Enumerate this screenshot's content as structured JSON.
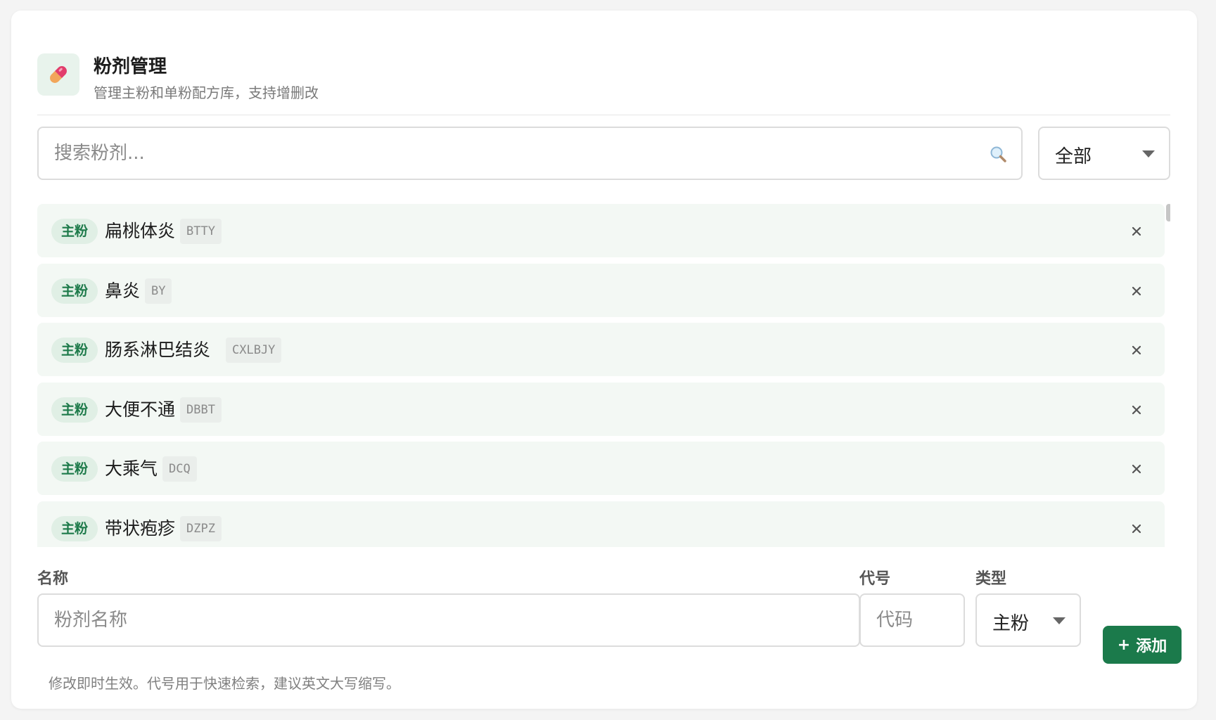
{
  "header": {
    "title": "粉剂管理",
    "subtitle": "管理主粉和单粉配方库，支持增删改",
    "logo_icon": "capsule-icon"
  },
  "search": {
    "placeholder": "搜索粉剂...",
    "value": "",
    "icon": "search-icon"
  },
  "filter": {
    "selected": "全部"
  },
  "powders": [
    {
      "type": "主粉",
      "name": "扁桃体炎",
      "code": "BTTY"
    },
    {
      "type": "主粉",
      "name": "鼻炎",
      "code": "BY"
    },
    {
      "type": "主粉",
      "name": "肠系淋巴结炎",
      "code": "CXLBJY"
    },
    {
      "type": "主粉",
      "name": "大便不通",
      "code": "DBBT"
    },
    {
      "type": "主粉",
      "name": "大乘气",
      "code": "DCQ"
    },
    {
      "type": "主粉",
      "name": "带状疱疹",
      "code": "DZPZ"
    }
  ],
  "form": {
    "name_label": "名称",
    "name_placeholder": "粉剂名称",
    "code_label": "代号",
    "code_placeholder": "代码",
    "type_label": "类型",
    "type_selected": "主粉",
    "add_button": "添加",
    "add_icon": "+"
  },
  "hint": "修改即时生效。代号用于快速检索，建议英文大写缩写。",
  "colors": {
    "accent": "#1b7a4b",
    "badge_bg": "#e0efe5",
    "row_bg": "#f3f8f4"
  }
}
